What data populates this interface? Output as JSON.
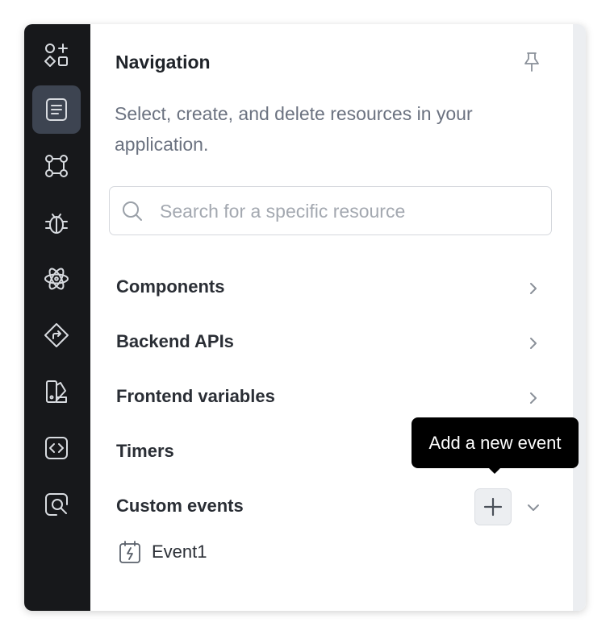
{
  "rail": {
    "items": [
      {
        "icon": "add-shapes-icon",
        "active": false
      },
      {
        "icon": "document-list-icon",
        "active": true
      },
      {
        "icon": "workflow-icon",
        "active": false
      },
      {
        "icon": "bug-icon",
        "active": false
      },
      {
        "icon": "react-atom-icon",
        "active": false
      },
      {
        "icon": "route-sign-icon",
        "active": false
      },
      {
        "icon": "theme-palette-icon",
        "active": false
      },
      {
        "icon": "code-icon",
        "active": false
      },
      {
        "icon": "inspect-search-icon",
        "active": false
      }
    ]
  },
  "panel": {
    "title": "Navigation",
    "description": "Select, create, and delete resources in your application.",
    "search": {
      "placeholder": "Search for a specific resource",
      "value": ""
    },
    "sections": [
      {
        "label": "Components"
      },
      {
        "label": "Backend APIs"
      },
      {
        "label": "Frontend variables"
      },
      {
        "label": "Timers"
      },
      {
        "label": "Custom events"
      }
    ],
    "events": [
      {
        "label": "Event1",
        "icon": "calendar-bolt-icon"
      }
    ]
  },
  "tooltip": {
    "text": "Add a new event"
  },
  "colors": {
    "rail_bg": "#17181b",
    "rail_active": "#3d4451",
    "tooltip_bg": "#000000"
  }
}
